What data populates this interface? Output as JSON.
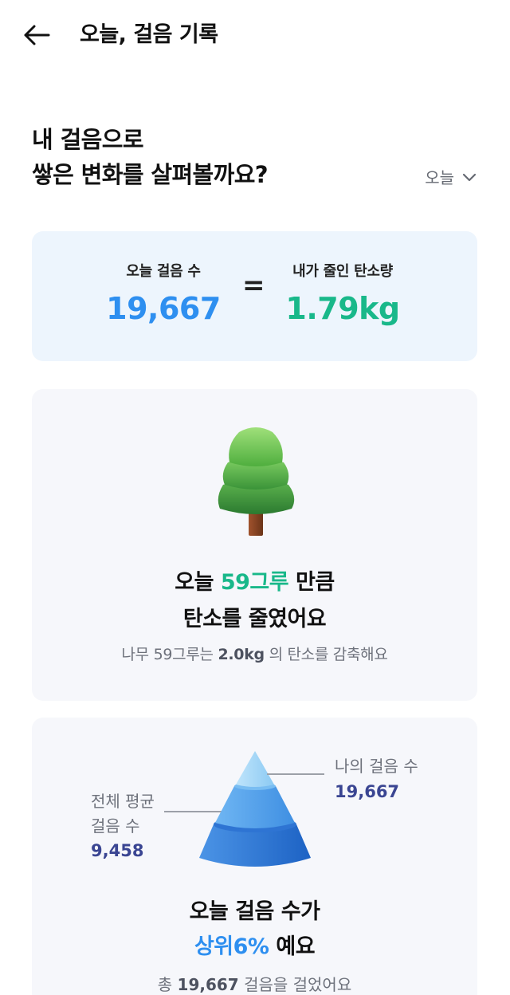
{
  "header": {
    "title": "오늘, 걸음 기록",
    "back_icon": "arrow-left-icon"
  },
  "headline": {
    "line1": "내 걸음으로",
    "line2": "쌓은 변화를 살펴볼까요?"
  },
  "period": {
    "selected": "오늘",
    "icon": "chevron-down-icon"
  },
  "summary": {
    "steps_label": "오늘 걸음 수",
    "steps_value": "19,667",
    "equals": "=",
    "carbon_label": "내가 줄인 탄소량",
    "carbon_value": "1.79kg"
  },
  "tree_card": {
    "icon": "tree-icon",
    "title_pre": "오늘 ",
    "title_highlight": "59그루",
    "title_post": " 만큼",
    "title_line2": "탄소를 줄였어요",
    "sub_pre": "나무 59그루는 ",
    "sub_bold": "2.0kg",
    "sub_post": " 의 탄소를 감축해요"
  },
  "rank_card": {
    "icon": "pyramid-icon",
    "avg_label_line1": "전체 평균",
    "avg_label_line2": "걸음 수",
    "avg_value": "9,458",
    "my_label": "나의 걸음 수",
    "my_value": "19,667",
    "title_line1": "오늘 걸음 수가",
    "title_highlight": "상위6%",
    "title_post": " 예요",
    "sub_pre": "총 ",
    "sub_bold": "19,667",
    "sub_post": " 걸음을 걸었어요"
  },
  "colors": {
    "blue": "#2e8ff0",
    "green": "#19b88a",
    "navy": "#3a4592",
    "summary_bg": "#edf5fd",
    "card_bg": "#f6f7fb"
  }
}
